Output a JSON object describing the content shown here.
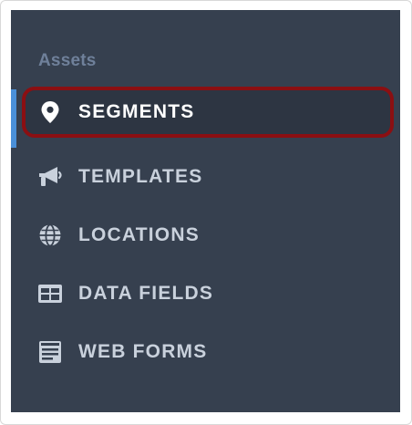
{
  "sidebar": {
    "section_title": "Assets",
    "items": [
      {
        "label": "SEGMENTS",
        "icon": "map-pin-icon",
        "active": true
      },
      {
        "label": "TEMPLATES",
        "icon": "megaphone-icon",
        "active": false
      },
      {
        "label": "LOCATIONS",
        "icon": "globe-icon",
        "active": false
      },
      {
        "label": "DATA FIELDS",
        "icon": "table-icon",
        "active": false
      },
      {
        "label": "WEB FORMS",
        "icon": "form-icon",
        "active": false
      }
    ]
  },
  "colors": {
    "panel_background": "#36404f",
    "active_item_background": "#2d3542",
    "highlight_outline": "#8b0f12",
    "active_indicator": "#4a90d9",
    "section_label": "#6f809a",
    "item_text": "#c9d1dc"
  }
}
